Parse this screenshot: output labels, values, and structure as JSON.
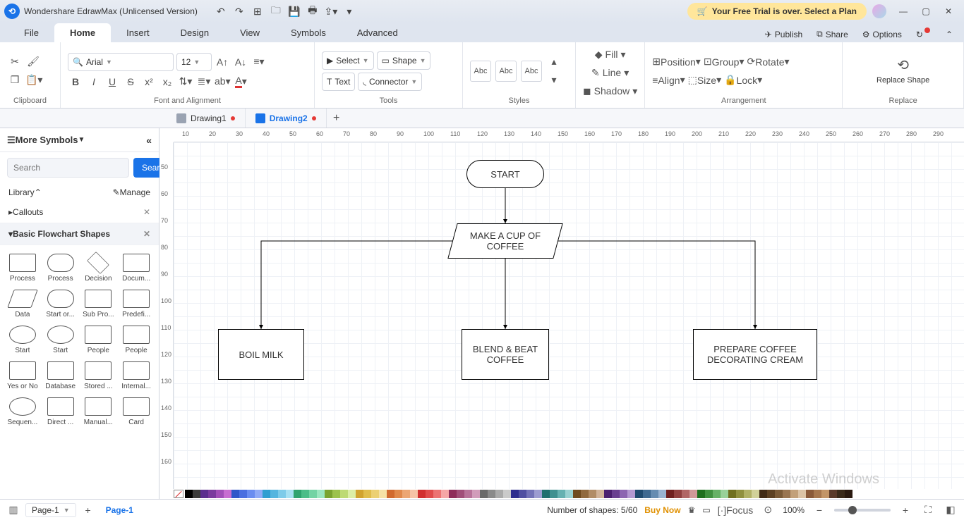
{
  "app": {
    "title": "Wondershare EdrawMax (Unlicensed Version)"
  },
  "trial": {
    "label": "Your Free Trial is over. Select a Plan"
  },
  "menu": {
    "items": [
      "File",
      "Home",
      "Insert",
      "Design",
      "View",
      "Symbols",
      "Advanced"
    ],
    "active": "Home"
  },
  "topright": {
    "publish": "Publish",
    "share": "Share",
    "options": "Options"
  },
  "ribbon": {
    "clipboard": "Clipboard",
    "font": {
      "name": "Arial",
      "size": "12",
      "group": "Font and Alignment"
    },
    "tools": {
      "select": "Select",
      "shape": "Shape",
      "text": "Text",
      "connector": "Connector",
      "group": "Tools"
    },
    "styles": {
      "abc": "Abc",
      "group": "Styles"
    },
    "shape_fmt": {
      "fill": "Fill",
      "line": "Line",
      "shadow": "Shadow"
    },
    "arrange": {
      "position": "Position",
      "align": "Align",
      "group_btn": "Group",
      "size": "Size",
      "rotate": "Rotate",
      "lock": "Lock",
      "group": "Arrangement"
    },
    "replace": {
      "btn": "Replace Shape",
      "group": "Replace"
    }
  },
  "doctabs": {
    "t1": "Drawing1",
    "t2": "Drawing2"
  },
  "leftpanel": {
    "title": "More Symbols",
    "search_ph": "Search",
    "search_btn": "Search",
    "library": "Library",
    "manage": "Manage",
    "cat1": "Callouts",
    "cat2": "Basic Flowchart Shapes",
    "shapes": [
      "Process",
      "Process",
      "Decision",
      "Docum...",
      "Data",
      "Start or...",
      "Sub Pro...",
      "Predefi...",
      "Start",
      "Start",
      "People",
      "People",
      "Yes or No",
      "Database",
      "Stored ...",
      "Internal...",
      "Sequen...",
      "Direct ...",
      "Manual...",
      "Card"
    ]
  },
  "flow": {
    "start": "START",
    "make": "MAKE A CUP OF COFFEE",
    "boil": "BOIL MILK",
    "blend": "BLEND & BEAT COFFEE",
    "prepare": "PREPARE COFFEE DECORATING CREAM"
  },
  "ruler_h": [
    "10",
    "20",
    "30",
    "40",
    "50",
    "60",
    "70",
    "80",
    "90",
    "100",
    "110",
    "120",
    "130",
    "140",
    "150",
    "160",
    "170",
    "180",
    "190",
    "200",
    "210",
    "220",
    "230",
    "240",
    "250",
    "260",
    "270",
    "280",
    "290"
  ],
  "ruler_v": [
    "50",
    "60",
    "70",
    "80",
    "90",
    "100",
    "110",
    "120",
    "130",
    "140",
    "150",
    "160"
  ],
  "status": {
    "page": "Page-1",
    "pagename": "Page-1",
    "shapes": "Number of shapes: 5/60",
    "buy": "Buy Now",
    "focus": "Focus",
    "zoom": "100%"
  },
  "watermark": "Activate Windows",
  "colors": [
    "#000000",
    "#3b3b3b",
    "#5b2d8e",
    "#7a3a9e",
    "#a14fb8",
    "#c76dd1",
    "#3056c9",
    "#4a6fe0",
    "#6a8df0",
    "#8faaf6",
    "#2f9ed1",
    "#55b5df",
    "#7dcbe9",
    "#a6e0f2",
    "#2fa36f",
    "#4cbd89",
    "#73d3a4",
    "#9be6c0",
    "#7aa32f",
    "#9cc24c",
    "#bdda73",
    "#dceea6",
    "#d1a32f",
    "#e0bd4c",
    "#ecd073",
    "#f6e2a6",
    "#d16a2f",
    "#e0894c",
    "#eca673",
    "#f6c3a6",
    "#d12f2f",
    "#e04c4c",
    "#ec7373",
    "#f6a6a6",
    "#8e2d5b",
    "#a14f7a",
    "#b8739a",
    "#d19cba",
    "#6a6a6a",
    "#8a8a8a",
    "#aaaaaa",
    "#cacaca",
    "#2d2d8e",
    "#4f4fa1",
    "#7373b8",
    "#9c9cd1",
    "#1f6f6f",
    "#3f9090",
    "#66b1b1",
    "#99d1d1",
    "#6f4a1f",
    "#90693f",
    "#b18c66",
    "#d1b399",
    "#4a1f6f",
    "#693f90",
    "#8c66b1",
    "#b399d1",
    "#1f4a6f",
    "#3f6990",
    "#668cb1",
    "#99b3d1",
    "#6f1f1f",
    "#903f3f",
    "#b16666",
    "#d19999",
    "#1f6f1f",
    "#3f903f",
    "#66b166",
    "#99d199",
    "#6f6f1f",
    "#90903f",
    "#b1b166",
    "#d1d199",
    "#402a16",
    "#5c4023",
    "#7a5a38",
    "#997552",
    "#c2a07a",
    "#dbc3a6",
    "#8a5a3a",
    "#a6774f",
    "#c29568",
    "#5a3a2a",
    "#3a2a1a",
    "#2a1a10"
  ]
}
